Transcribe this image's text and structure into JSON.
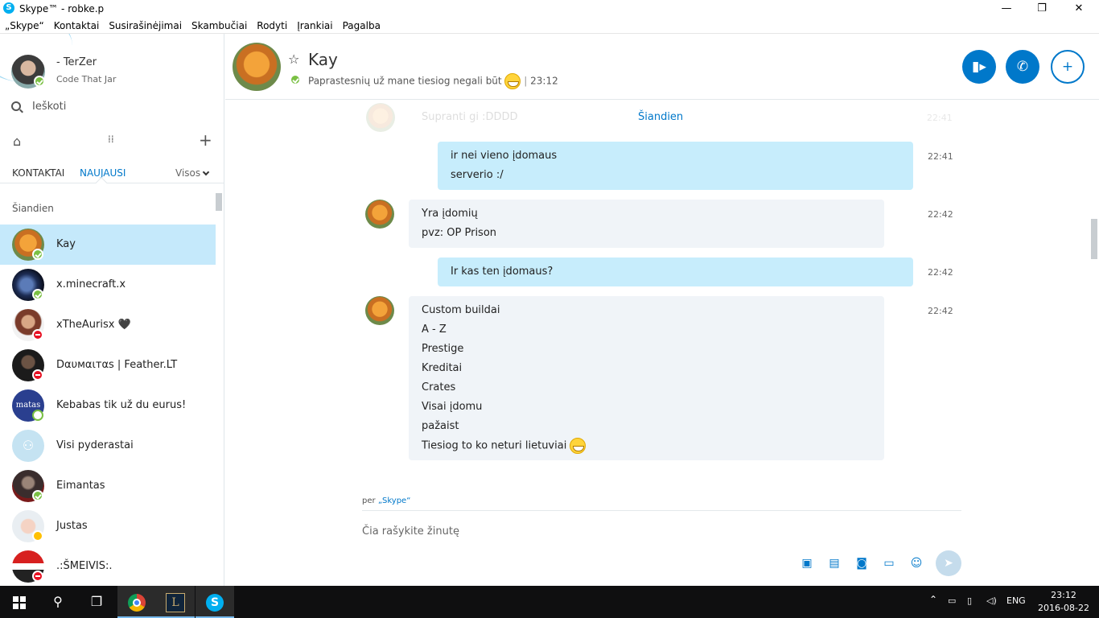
{
  "window": {
    "title": "Skype™ - robke.p",
    "minimize": "—",
    "restore": "❐",
    "close": "✕"
  },
  "menu": [
    "„Skype“",
    "Kontaktai",
    "Susirašinėjimai",
    "Skambučiai",
    "Rodyti",
    "Įrankiai",
    "Pagalba"
  ],
  "profile": {
    "name": "-   TerZer",
    "mood": "Code That Jar"
  },
  "search": {
    "placeholder": "Ieškoti"
  },
  "tabs": {
    "contacts": "KONTAKTAI",
    "recent": "NAUJAUSI",
    "filter": "Visos"
  },
  "section_today": "Šiandien",
  "contacts": [
    {
      "name": "Kay",
      "status": "online",
      "selected": true
    },
    {
      "name": "x.minecraft.x",
      "status": "online"
    },
    {
      "name": "xTheAurisx 🖤",
      "status": "busy"
    },
    {
      "name": "Dαυмαιтαѕ | Feather.LT",
      "status": "busy"
    },
    {
      "name": "Kebabas tik už du eurus!",
      "status": "offline"
    },
    {
      "name": "Visi pyderastai",
      "status": "group"
    },
    {
      "name": "Eimantas",
      "status": "online"
    },
    {
      "name": "Justas",
      "status": "away"
    },
    {
      "name": ".:ŠMEIVIS:.",
      "status": "busy"
    }
  ],
  "chat": {
    "name": "Kay",
    "mood": "Paprastesnių už mane tiesiog negali būt",
    "mood_time": "23:12",
    "day_separator": "Šiandien",
    "faded_text": "Supranti gi :DDDD",
    "faded_time": "22:41",
    "messages": [
      {
        "dir": "out",
        "lines": [
          "ir nei vieno įdomaus",
          "serverio :/"
        ],
        "time": "22:41"
      },
      {
        "dir": "in",
        "lines": [
          "Yra įdomių",
          "pvz: OP Prison"
        ],
        "time": "22:42"
      },
      {
        "dir": "out",
        "lines": [
          "Ir kas ten įdomaus?"
        ],
        "time": "22:42"
      },
      {
        "dir": "in",
        "lines": [
          "Custom buildai",
          "A - Z",
          "Prestige",
          "Kreditai",
          "Crates",
          "Visai įdomu",
          "pažaist",
          "Tiesiog to ko neturi lietuviai"
        ],
        "time": "22:42"
      }
    ],
    "via_prefix": "per",
    "via_link": "„Skype“",
    "compose_placeholder": "Čia rašykite žinutę"
  },
  "taskbar": {
    "lang": "ENG",
    "time": "23:12",
    "date": "2016-08-22"
  },
  "colors": {
    "accent": "#0078ca",
    "selected": "#c5e9fb",
    "bubble_out": "#c7edfc",
    "bubble_in": "#f0f4f8",
    "online": "#7ac043",
    "busy": "#e81123",
    "away": "#ffc000"
  }
}
